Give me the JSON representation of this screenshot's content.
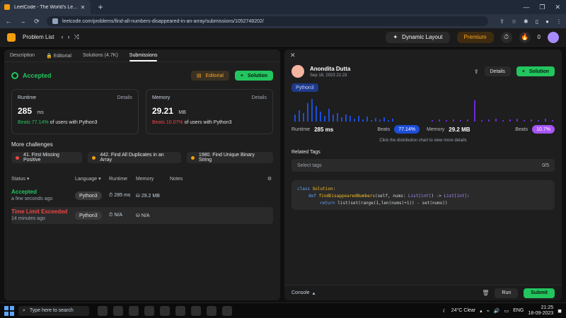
{
  "browser": {
    "tab_title": "LeetCode - The World's Leading",
    "url": "leetcode.com/problems/find-all-numbers-disappeared-in-an-array/submissions/1052748202/"
  },
  "lc_header": {
    "title": "Problem List",
    "dynamic_layout": "Dynamic Layout",
    "premium": "Premium",
    "notif_count": "0"
  },
  "left": {
    "tabs": [
      {
        "label": "Description"
      },
      {
        "label": "Editorial"
      },
      {
        "label": "Solutions (4.7K)"
      },
      {
        "label": "Submissions"
      }
    ],
    "accepted_text": "Accepted",
    "editorial_btn": "Editorial",
    "solution_btn": "Solution",
    "runtime": {
      "title": "Runtime",
      "details": "Details",
      "value": "285",
      "unit": "ms",
      "beats_prefix": "Beats",
      "beats_pct": "77.14%",
      "beats_suffix": "of users with Python3"
    },
    "memory": {
      "title": "Memory",
      "details": "Details",
      "value": "29.21",
      "unit": "MB",
      "beats_prefix": "Beats",
      "beats_pct": "10.07%",
      "beats_suffix": "of users with Python3"
    },
    "more_challenges": "More challenges",
    "challenges": [
      {
        "label": "41. First Missing Positive",
        "dot": "red"
      },
      {
        "label": "442. Find All Duplicates in an Array",
        "dot": "orange"
      },
      {
        "label": "1980. Find Unique Binary String",
        "dot": "orange"
      }
    ],
    "list_headers": {
      "status": "Status",
      "language": "Language",
      "runtime": "Runtime",
      "memory": "Memory",
      "notes": "Notes"
    },
    "submissions": [
      {
        "status": "Accepted",
        "time": "a few seconds ago",
        "lang": "Python3",
        "runtime": "285 ms",
        "memory": "29.2 MB",
        "ok": true
      },
      {
        "status": "Time Limit Exceeded",
        "time": "14 minutes ago",
        "lang": "Python3",
        "runtime": "N/A",
        "memory": "N/A",
        "ok": false
      }
    ]
  },
  "right": {
    "user_name": "Anondita Dutta",
    "user_date": "Sep 18, 2023 21:23",
    "details_btn": "Details",
    "solution_btn": "Solution",
    "lang_badge": "Python3",
    "runtime_label": "Runtime",
    "runtime_value": "285 ms",
    "runtime_beats_label": "Beats",
    "runtime_beats_pct": "77.14%",
    "memory_label": "Memory",
    "memory_value": "29.2 MB",
    "memory_beats_label": "Beats",
    "memory_beats_pct": "10.7%",
    "hint": "Click the distribution chart to view more details",
    "related_tags": "Related Tags",
    "tags_placeholder": "Select tags",
    "tags_count": "0/5",
    "code": {
      "line1_kw": "class",
      "line1_name": "Solution",
      "line1_end": ":",
      "line2_kw": "def",
      "line2_fn": "findDisappearedNumbers",
      "line2_mid": "(self, nums: ",
      "line2_type1": "List",
      "line2_type1_param": "[int]",
      "line2_arrow": ") -> ",
      "line2_type2": "List",
      "line2_type2_param": "[int]",
      "line2_end": ":",
      "line3_kw": "return",
      "line3_body": " list(set(range(1,len(nums)+1)) - set(nums))"
    },
    "console": "Console",
    "run": "Run",
    "submit": "Submit"
  },
  "taskbar": {
    "search_placeholder": "Type here to search",
    "weather": "24°C  Clear",
    "lang": "ENG",
    "time": "21:25",
    "date": "18-09-2023"
  },
  "colors": {
    "accent_green": "#22c55e",
    "accent_orange": "#f59e0b",
    "accent_blue": "#1d4ed8",
    "accent_purple": "#a855f7"
  }
}
